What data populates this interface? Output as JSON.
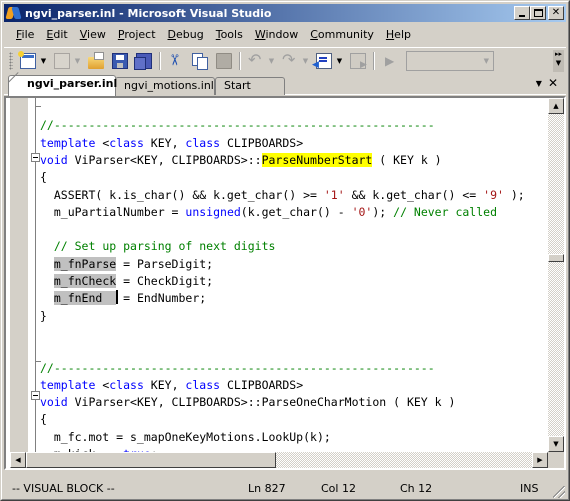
{
  "window": {
    "title": "ngvi_parser.inl - Microsoft Visual Studio",
    "buttons": {
      "minimize": "minimize",
      "maximize": "maximize",
      "close": "✕"
    }
  },
  "menu": [
    {
      "label": "File",
      "accel": "F"
    },
    {
      "label": "Edit",
      "accel": "E"
    },
    {
      "label": "View",
      "accel": "V"
    },
    {
      "label": "Project",
      "accel": "P"
    },
    {
      "label": "Debug",
      "accel": "D"
    },
    {
      "label": "Tools",
      "accel": "T"
    },
    {
      "label": "Window",
      "accel": "W"
    },
    {
      "label": "Community",
      "accel": "C"
    },
    {
      "label": "Help",
      "accel": "H"
    }
  ],
  "toolbar": {
    "icons": [
      "new-project-icon",
      "add-item-icon",
      "open-file-icon",
      "save-icon",
      "save-all-icon",
      "cut-icon",
      "copy-icon",
      "paste-icon",
      "undo-icon",
      "redo-icon",
      "navigate-backward-icon",
      "navigate-forward-icon",
      "start-debugging-icon"
    ],
    "combo_value": "",
    "overflow": "»"
  },
  "tabs": [
    {
      "label": "ngvi_parser.inl",
      "active": true
    },
    {
      "label": "ngvi_motions.inl",
      "active": false
    },
    {
      "label": "Start Page",
      "active": false
    }
  ],
  "tab_tools": {
    "dropdown": "▼",
    "close": "✕"
  },
  "code": {
    "lines": [
      {
        "segments": []
      },
      {
        "segments": [
          {
            "t": "//-------------------------------------------------------",
            "c": "cm"
          }
        ]
      },
      {
        "segments": [
          {
            "t": "template",
            "c": "kw"
          },
          {
            "t": " <"
          },
          {
            "t": "class",
            "c": "kw"
          },
          {
            "t": " KEY, "
          },
          {
            "t": "class",
            "c": "kw"
          },
          {
            "t": " CLIPBOARDS>"
          }
        ]
      },
      {
        "segments": [
          {
            "t": "void",
            "c": "kw"
          },
          {
            "t": " ViParser<KEY, CLIPBOARDS>::"
          },
          {
            "t": "ParseNumberStart",
            "c": "hl"
          },
          {
            "t": " ( KEY k )"
          }
        ]
      },
      {
        "segments": [
          {
            "t": "{"
          }
        ]
      },
      {
        "segments": [
          {
            "t": "  ASSERT( k.is_char() && k.get_char() >= "
          },
          {
            "t": "'1'",
            "c": "str"
          },
          {
            "t": " && k.get_char() <= "
          },
          {
            "t": "'9'",
            "c": "str"
          },
          {
            "t": " );"
          }
        ]
      },
      {
        "segments": [
          {
            "t": "  m_uPartialNumber = "
          },
          {
            "t": "unsigned",
            "c": "kw"
          },
          {
            "t": "(k.get_char() - "
          },
          {
            "t": "'0'",
            "c": "str"
          },
          {
            "t": "); "
          },
          {
            "t": "// Never called",
            "c": "cm"
          }
        ]
      },
      {
        "segments": []
      },
      {
        "segments": [
          {
            "t": "  "
          },
          {
            "t": "// Set up parsing of next digits",
            "c": "cm"
          }
        ]
      },
      {
        "segments": [
          {
            "t": "  "
          },
          {
            "t": "m_fnParse",
            "c": "sel"
          },
          {
            "t": " = ParseDigit;"
          }
        ]
      },
      {
        "segments": [
          {
            "t": "  "
          },
          {
            "t": "m_fnCheck",
            "c": "sel"
          },
          {
            "t": " = CheckDigit;"
          }
        ]
      },
      {
        "segments": [
          {
            "t": "  "
          },
          {
            "t": "m_fnEnd  ",
            "c": "sel"
          },
          {
            "t": "",
            "caret": true
          },
          {
            "t": " = EndNumber;"
          }
        ]
      },
      {
        "segments": [
          {
            "t": "}"
          }
        ]
      },
      {
        "segments": []
      },
      {
        "segments": []
      },
      {
        "segments": [
          {
            "t": "//-------------------------------------------------------",
            "c": "cm"
          }
        ]
      },
      {
        "segments": [
          {
            "t": "template",
            "c": "kw"
          },
          {
            "t": " <"
          },
          {
            "t": "class",
            "c": "kw"
          },
          {
            "t": " KEY, "
          },
          {
            "t": "class",
            "c": "kw"
          },
          {
            "t": " CLIPBOARDS>"
          }
        ]
      },
      {
        "segments": [
          {
            "t": "void",
            "c": "kw"
          },
          {
            "t": " ViParser<KEY, CLIPBOARDS>::ParseOneCharMotion ( KEY k )"
          }
        ]
      },
      {
        "segments": [
          {
            "t": "{"
          }
        ]
      },
      {
        "segments": [
          {
            "t": "  m_fc.mot = s_mapOneKeyMotions.LookUp(k);"
          }
        ]
      },
      {
        "segments": [
          {
            "t": "  m_kick  = "
          },
          {
            "t": "true",
            "c": "kw"
          },
          {
            "t": ";"
          }
        ]
      },
      {
        "segments": [
          {
            "t": "}"
          }
        ]
      }
    ]
  },
  "status": {
    "mode": "-- VISUAL BLOCK --",
    "line": "Ln 827",
    "col": "Col 12",
    "ch": "Ch 12",
    "ins": "INS"
  }
}
